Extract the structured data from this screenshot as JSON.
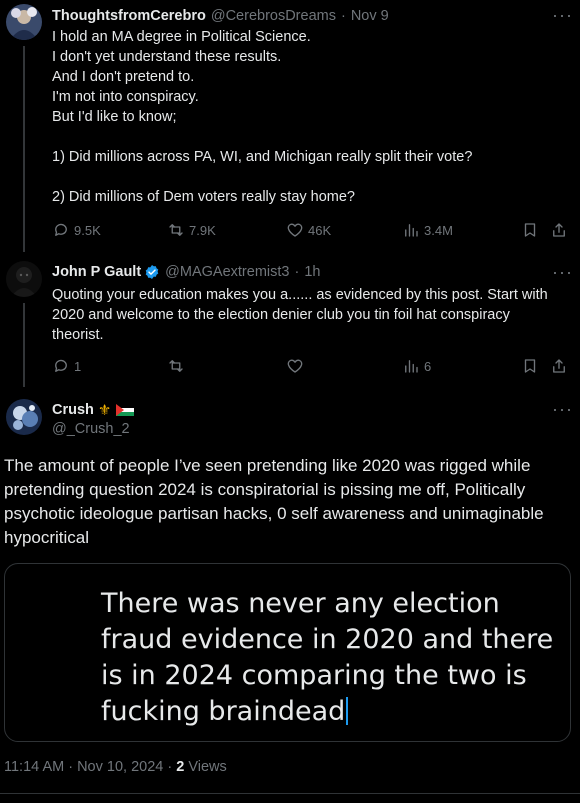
{
  "tweet1": {
    "name": "ThoughtsfromCerebro",
    "handle": "@CerebrosDreams",
    "sep": "·",
    "time": "Nov 9",
    "body": "I hold an MA degree in Political Science.\nI don't yet understand these results.\nAnd I don't pretend to.\nI'm not into conspiracy.\nBut I'd like to know;\n\n1) Did millions across PA, WI, and Michigan really split their vote?\n\n2) Did millions of Dem voters really stay home?",
    "replies": "9.5K",
    "reposts": "7.9K",
    "likes": "46K",
    "views": "3.4M"
  },
  "tweet2": {
    "name": "John P Gault",
    "handle": "@MAGAextremist3",
    "sep": "·",
    "time": "1h",
    "body": "Quoting your education makes you a...... as evidenced by this post. Start with 2020 and welcome to the election denier club you tin foil hat conspiracy theorist.",
    "replies": "1",
    "reposts": "",
    "likes": "",
    "views": "6"
  },
  "main_tweet": {
    "name": "Crush",
    "name_emoji": "⚜",
    "handle": "@_Crush_2",
    "body": "The amount of people I’ve seen pretending like 2020 was rigged while pretending question 2024 is conspiratorial is pissing me off, Politically psychotic ideologue partisan hacks, 0 self awareness and unimaginable hypocritical",
    "media_text": "There was never any election fraud evidence in 2020 and there is in 2024 comparing the two is fucking braindead",
    "timestamp": "11:14 AM · Nov 10, 2024 · ",
    "views_count": "2",
    "views_label": " Views"
  },
  "icons": {
    "more": "more-icon",
    "reply": "reply-icon",
    "repost": "repost-icon",
    "like": "like-icon",
    "views": "views-icon",
    "bookmark": "bookmark-icon",
    "share": "share-icon"
  },
  "colors": {
    "background": "#000000",
    "text": "#e7e9ea",
    "muted": "#71767b",
    "accent": "#1d9bf0",
    "divider": "#2f3336"
  }
}
